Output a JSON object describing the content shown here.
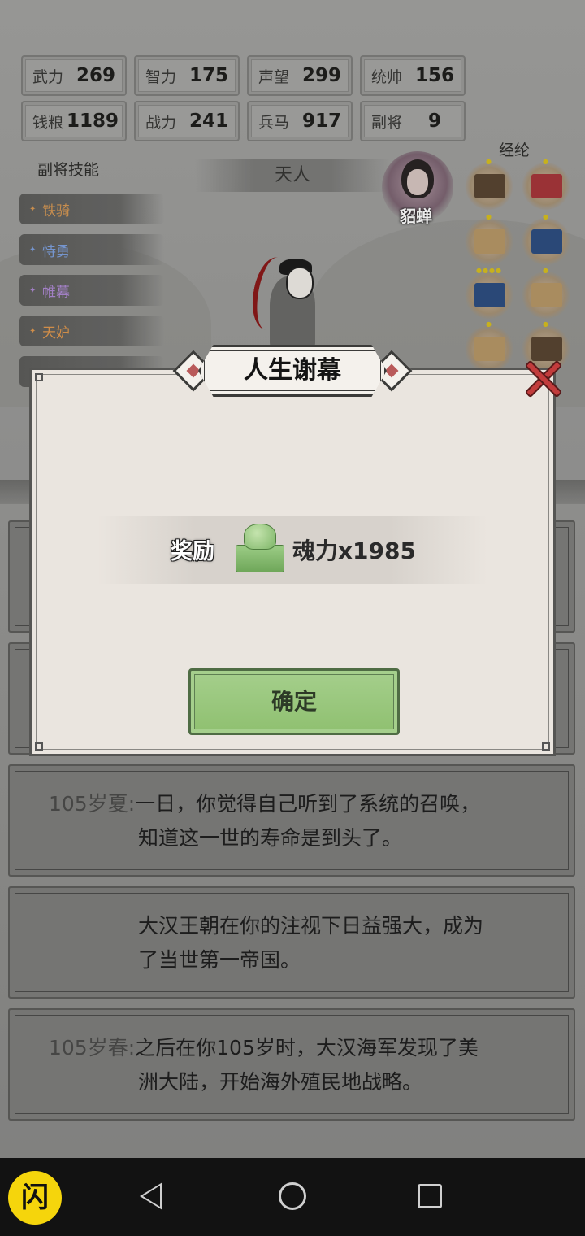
{
  "stats": [
    {
      "label": "武力",
      "value": "269"
    },
    {
      "label": "智力",
      "value": "175"
    },
    {
      "label": "声望",
      "value": "299"
    },
    {
      "label": "统帅",
      "value": "156"
    },
    {
      "label": "钱粮",
      "value": "1189"
    },
    {
      "label": "战力",
      "value": "241"
    },
    {
      "label": "兵马",
      "value": "917"
    },
    {
      "label": "副将",
      "value": "9"
    }
  ],
  "skills_title": "副将技能",
  "skills": [
    {
      "label": "铁骑",
      "color": "#d89a55"
    },
    {
      "label": "恃勇",
      "color": "#7fa2e0"
    },
    {
      "label": "帷幕",
      "color": "#b08bd6"
    },
    {
      "label": "天妒",
      "color": "#e29a50"
    }
  ],
  "title_banner": "天人",
  "companion_name": "貂蝉",
  "lunlun_title": "经纶",
  "dialog": {
    "title": "人生谢幕",
    "reward_label": "奖励",
    "reward_amount": "魂力x1985",
    "confirm_label": "确定"
  },
  "log": [
    {
      "age": "105岁夏:",
      "line1": "一日，你觉得自己听到了系统的召唤，",
      "line2": "知道这一世的寿命是到头了。"
    },
    {
      "age": "",
      "line1": "大汉王朝在你的注视下日益强大，成为",
      "line2": "了当世第一帝国。"
    },
    {
      "age": "105岁春:",
      "line1": "之后在你105岁时，大汉海军发现了美",
      "line2": "洲大陆，开始海外殖民地战略。"
    }
  ],
  "nav": {
    "app_icon": "闪"
  }
}
